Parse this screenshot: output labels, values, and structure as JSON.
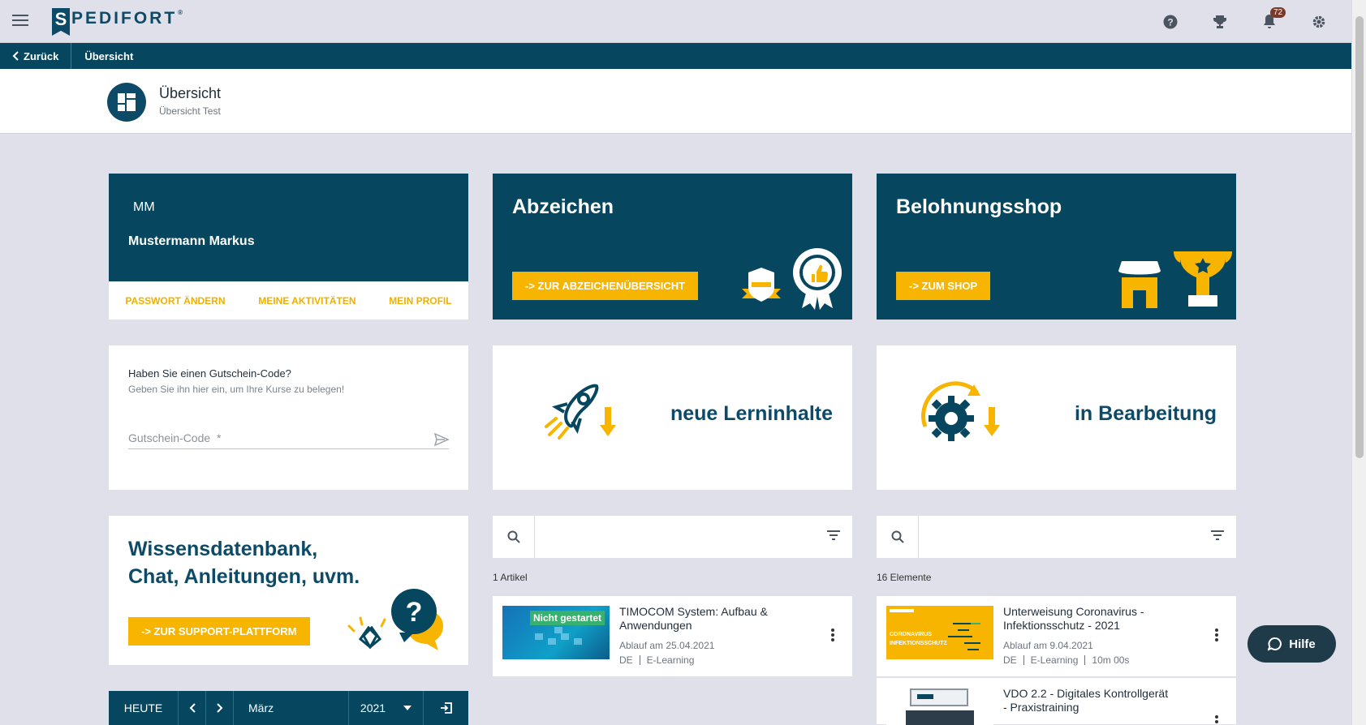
{
  "topbar": {
    "logo_letter": "S",
    "logo_text": "PEDIFORT",
    "logo_reg": "®",
    "notification_count": "72"
  },
  "nav": {
    "back_label": "Zurück",
    "crumb": "Übersicht"
  },
  "header": {
    "title": "Übersicht",
    "subtitle": "Übersicht Test"
  },
  "profile": {
    "initials": "MM",
    "name": "Mustermann Markus",
    "links": [
      "PASSWORT ÄNDERN",
      "MEINE AKTIVITÄTEN",
      "MEIN PROFIL"
    ]
  },
  "badges": {
    "title": "Abzeichen",
    "button": "-> ZUR ABZEICHENÜBERSICHT"
  },
  "shop": {
    "title": "Belohnungsshop",
    "button": "-> ZUM SHOP"
  },
  "voucher": {
    "question": "Haben Sie einen Gutschein-Code?",
    "hint": "Geben Sie ihn hier ein, um Ihre Kurse zu belegen!",
    "placeholder": "Gutschein-Code  *"
  },
  "tiles": {
    "new_content": "neue Lerninhalte",
    "in_progress": "in Bearbeitung"
  },
  "support": {
    "title": "Wissensdatenbank, Chat, Anleitungen, uvm.",
    "button": "-> ZUR SUPPORT-PLATTFORM"
  },
  "list_left": {
    "count": "1 Artikel",
    "items": [
      {
        "badge": "Nicht gestartet",
        "title": "TIMOCOM System: Aufbau & Anwendungen",
        "date": "Ablauf am 25.04.2021",
        "meta": [
          "DE",
          "E-Learning"
        ]
      }
    ]
  },
  "list_right": {
    "count": "16 Elemente",
    "items": [
      {
        "thumb_text": "CORONAVIRUS INFEKTIONSSCHUTZ",
        "title": "Unterweisung Coronavirus - Infektionsschutz - 2021",
        "date": "Ablauf am 9.04.2021",
        "meta": [
          "DE",
          "E-Learning",
          "10m 00s"
        ]
      },
      {
        "title": "VDO 2.2 - Digitales Kontrollgerät - Praxistraining"
      }
    ]
  },
  "calendar": {
    "today": "HEUTE",
    "month": "März",
    "year": "2021"
  },
  "help": {
    "label": "Hilfe"
  },
  "colors": {
    "primary": "#06475f",
    "accent": "#f7b500",
    "background": "#dfe0e9"
  }
}
